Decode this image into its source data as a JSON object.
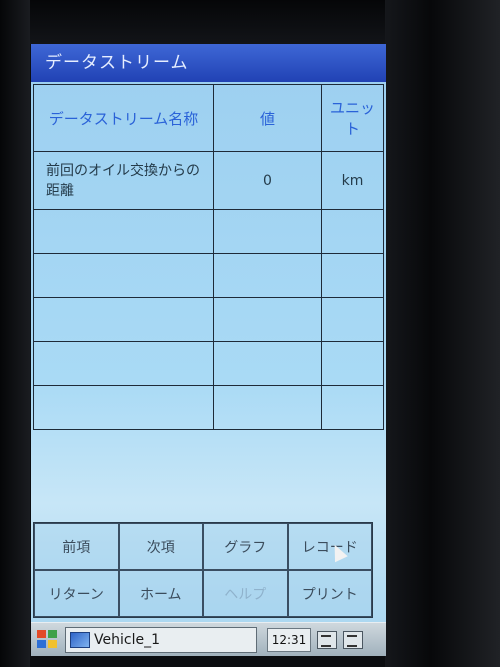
{
  "window": {
    "title": "データストリーム"
  },
  "table": {
    "headers": [
      "データストリーム名称",
      "値",
      "ユニット"
    ],
    "rows": [
      {
        "name": "前回のオイル交換からの距離",
        "value": "0",
        "unit": "km"
      }
    ]
  },
  "buttons": {
    "prev": "前項",
    "next": "次項",
    "graph": "グラフ",
    "record": "レコード",
    "return": "リターン",
    "home": "ホーム",
    "help": "ヘルプ",
    "print": "プリント"
  },
  "taskbar": {
    "start_icon": "windows-flag-icon",
    "task_label": "Vehicle_1",
    "time": "12:31",
    "tray_icons": [
      "keyboard-icon",
      "window-switch-icon"
    ]
  }
}
